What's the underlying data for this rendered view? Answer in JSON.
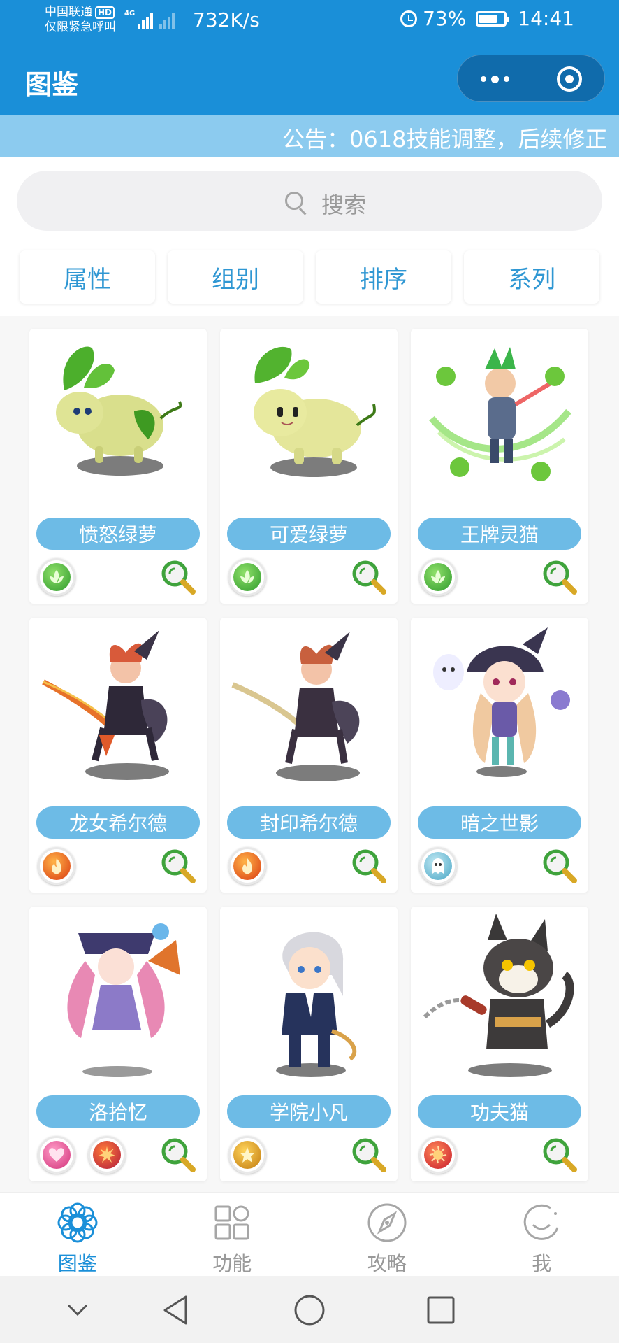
{
  "status_bar": {
    "carrier_line1": "中国联通",
    "hd": "HD",
    "carrier_line2": "仅限紧急呼叫",
    "network": "4G",
    "net_speed": "732K/s",
    "battery_percent": "73%",
    "battery_level": 0.73,
    "time": "14:41"
  },
  "header": {
    "title": "图鉴"
  },
  "notice": {
    "text": "公告：0618技能调整，后续修正"
  },
  "search": {
    "placeholder": "搜索"
  },
  "filters": [
    "属性",
    "组别",
    "排序",
    "系列"
  ],
  "cards": [
    {
      "name": "愤怒绿萝",
      "attributes": [
        "grass-icon"
      ]
    },
    {
      "name": "可爱绿萝",
      "attributes": [
        "grass-icon"
      ]
    },
    {
      "name": "王牌灵猫",
      "attributes": [
        "grass-icon"
      ]
    },
    {
      "name": "龙女希尔德",
      "attributes": [
        "fire-icon"
      ]
    },
    {
      "name": "封印希尔德",
      "attributes": [
        "fire-icon"
      ]
    },
    {
      "name": "暗之世影",
      "attributes": [
        "ghost-icon"
      ]
    },
    {
      "name": "洛拾忆",
      "attributes": [
        "heart-icon",
        "burst-icon"
      ]
    },
    {
      "name": "学院小凡",
      "attributes": [
        "star-icon"
      ]
    },
    {
      "name": "功夫猫",
      "attributes": [
        "flame-icon"
      ]
    }
  ],
  "tabs": [
    {
      "label": "图鉴",
      "icon": "flower-icon",
      "active": true
    },
    {
      "label": "功能",
      "icon": "grid-icon",
      "active": false
    },
    {
      "label": "攻略",
      "icon": "compass-icon",
      "active": false
    },
    {
      "label": "我",
      "icon": "smile-icon",
      "active": false
    }
  ],
  "colors": {
    "primary": "#1a8fd8",
    "notice_bg": "#8ccbef",
    "pill": "#6dbbe6",
    "filter_text": "#2f97d3"
  }
}
